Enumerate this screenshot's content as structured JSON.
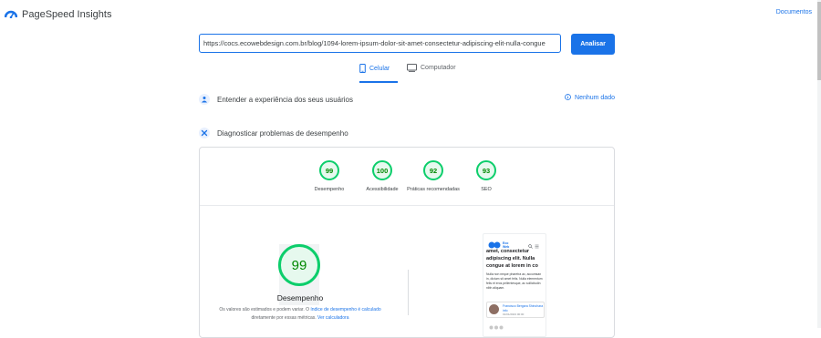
{
  "header": {
    "app_title": "PageSpeed Insights",
    "docs_link": "Documentos"
  },
  "search": {
    "url_value": "https://cocs.ecowebdesign.com.br/blog/1094-lorem-ipsum-dolor-sit-amet-consectetur-adipiscing-elit-nulla-congue",
    "analyze_label": "Analisar"
  },
  "tabs": [
    {
      "label": "Celular",
      "icon": "smartphone-icon",
      "active": true
    },
    {
      "label": "Computador",
      "icon": "desktop-icon",
      "active": false
    }
  ],
  "sections": {
    "experience": {
      "title": "Entender a experiência dos seus usuários",
      "no_data": "Nenhum dado"
    },
    "diagnose": {
      "title": "Diagnosticar problemas de desempenho"
    }
  },
  "scores": [
    {
      "value": "99",
      "label": "Desempenho"
    },
    {
      "value": "100",
      "label": "Acessibilidade"
    },
    {
      "value": "92",
      "label": "Práticas recomendadas"
    },
    {
      "value": "93",
      "label": "SEO"
    }
  ],
  "performance": {
    "score": "99",
    "label": "Desempenho",
    "note_pre": "Os valores são estimados e podem variar. O ",
    "note_link1": "índice de desempenho é calculado",
    "note_mid": " diretamente por essas métricas. ",
    "note_link2": "Ver calculadora"
  },
  "preview": {
    "logo_text": "Eco Web",
    "heading": "amet, consectetur adipiscing elit. Nulla congue at lorem in co",
    "body": "Nulla non neque pharetra ac, accumsan in, dictum sit amet felis. Nulla elementum felis et eros pellentesque, ac sollicitudin nibh aliquam.",
    "author_name": "Francisco Bergara Shinohara info",
    "author_date": "01/01/2023 00:00"
  },
  "colors": {
    "accent": "#1a73e8",
    "good": "#0cce6b",
    "good_text": "#008800"
  }
}
